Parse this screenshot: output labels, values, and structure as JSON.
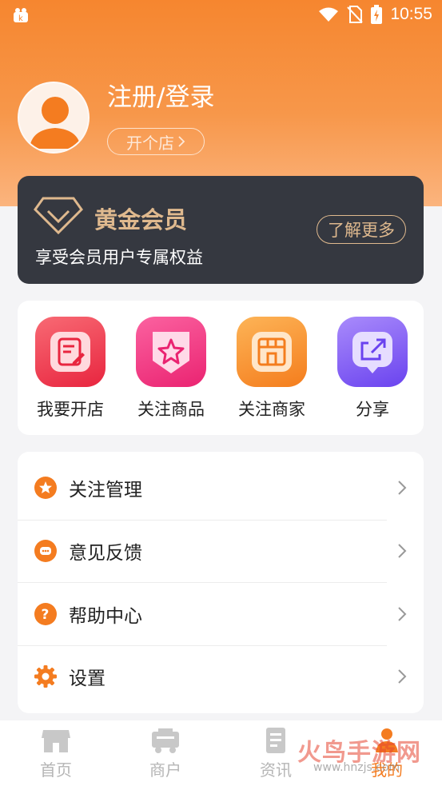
{
  "status_bar": {
    "time": "10:55",
    "icons": [
      "wifi-icon",
      "no-sim-icon",
      "battery-charging-icon"
    ]
  },
  "profile": {
    "login_label": "注册/登录",
    "open_shop_label": "开个店",
    "avatar_icon": "user-avatar-icon"
  },
  "vip": {
    "title": "黄金会员",
    "subtitle": "享受会员用户专属权益",
    "more_label": "了解更多",
    "accent_color": "#dfb98e",
    "background_color": "#353840"
  },
  "quick_actions": [
    {
      "label": "我要开店",
      "icon": "edit-document-icon",
      "color": "#ef3f58"
    },
    {
      "label": "关注商品",
      "icon": "star-badge-icon",
      "color": "#f2397e"
    },
    {
      "label": "关注商家",
      "icon": "storefront-icon",
      "color": "#f7912e"
    },
    {
      "label": "分享",
      "icon": "share-icon",
      "color": "#7b58f2"
    }
  ],
  "menu": [
    {
      "label": "关注管理",
      "icon": "star-circle-icon"
    },
    {
      "label": "意见反馈",
      "icon": "chat-circle-icon"
    },
    {
      "label": "帮助中心",
      "icon": "help-circle-icon"
    },
    {
      "label": "设置",
      "icon": "gear-icon"
    }
  ],
  "bottom_nav": [
    {
      "label": "首页",
      "icon": "home-store-icon",
      "active": false
    },
    {
      "label": "商户",
      "icon": "merchant-truck-icon",
      "active": false
    },
    {
      "label": "资讯",
      "icon": "news-icon",
      "active": false
    },
    {
      "label": "我的",
      "icon": "profile-icon",
      "active": true
    }
  ],
  "watermark": {
    "text": "火鸟手游网",
    "url": "www.hnzjs.com"
  },
  "colors": {
    "brand_orange": "#f6862f",
    "active_tab": "#f47c20",
    "inactive_tab": "#b5b5b5"
  }
}
